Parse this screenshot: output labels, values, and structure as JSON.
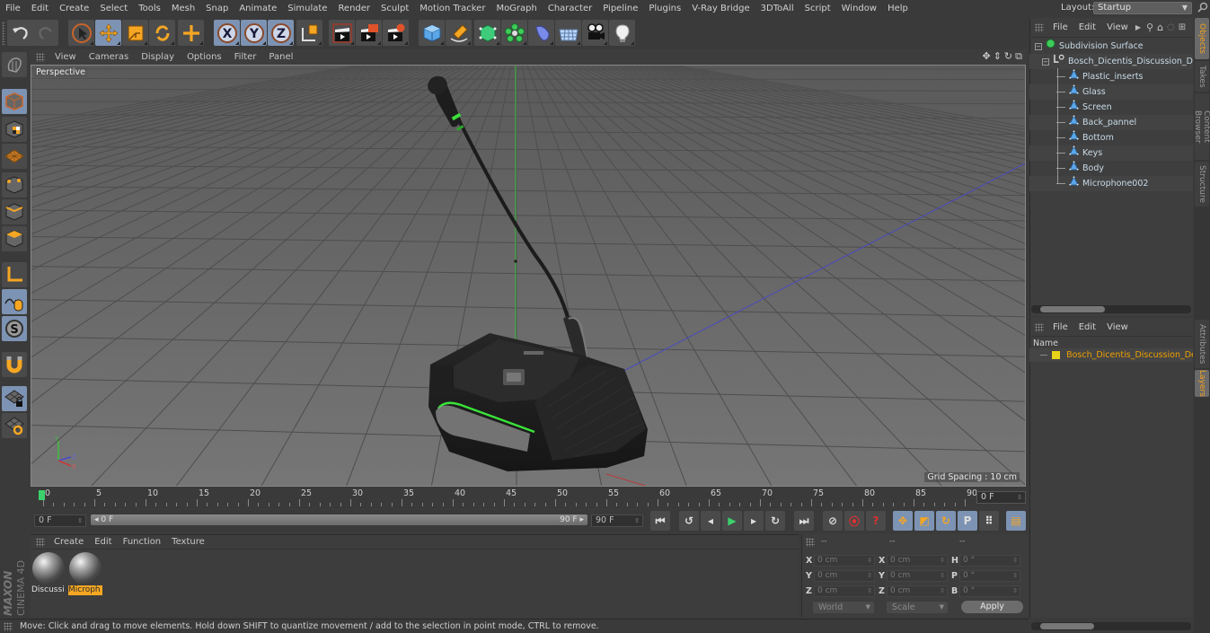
{
  "menubar": {
    "items": [
      "File",
      "Edit",
      "Create",
      "Select",
      "Tools",
      "Mesh",
      "Snap",
      "Animate",
      "Simulate",
      "Render",
      "Sculpt",
      "Motion Tracker",
      "MoGraph",
      "Character",
      "Pipeline",
      "Plugins",
      "V-Ray Bridge",
      "3DToAll",
      "Script",
      "Window",
      "Help"
    ],
    "layout_label": "Layout:",
    "layout_value": "Startup"
  },
  "toolbar": {
    "buttons": [
      {
        "name": "undo",
        "icon": "undo-icon",
        "active": false
      },
      {
        "name": "redo",
        "icon": "redo-icon",
        "active": false
      },
      {
        "name": "live-selection",
        "icon": "cursor-icon",
        "active": false
      },
      {
        "name": "move",
        "icon": "move-icon",
        "active": true
      },
      {
        "name": "scale",
        "icon": "scale-icon",
        "active": false
      },
      {
        "name": "rotate",
        "icon": "rotate-icon",
        "active": false
      },
      {
        "name": "last-tool",
        "icon": "plus-icon",
        "active": false
      },
      {
        "name": "x-axis",
        "icon": "x-axis-icon",
        "label": "X",
        "active": true
      },
      {
        "name": "y-axis",
        "icon": "y-axis-icon",
        "label": "Y",
        "active": true
      },
      {
        "name": "z-axis",
        "icon": "z-axis-icon",
        "label": "Z",
        "active": true
      },
      {
        "name": "coordinate-system",
        "icon": "coordinate-system-icon",
        "active": false
      },
      {
        "name": "render-view",
        "icon": "clapboard-icon",
        "active": false
      },
      {
        "name": "render-to-picture-viewer",
        "icon": "clapboard-render-icon",
        "active": false
      },
      {
        "name": "render-settings",
        "icon": "clapboard-gear-icon",
        "active": false
      },
      {
        "name": "cube",
        "icon": "cube-icon",
        "active": false
      },
      {
        "name": "pen",
        "icon": "pen-icon",
        "active": false
      },
      {
        "name": "subdivision-surface",
        "icon": "subdivision-icon",
        "active": false
      },
      {
        "name": "cloner",
        "icon": "cloner-icon",
        "active": false
      },
      {
        "name": "deformer",
        "icon": "deformer-icon",
        "active": false
      },
      {
        "name": "floor",
        "icon": "floor-icon",
        "active": false
      },
      {
        "name": "camera",
        "icon": "camera-icon",
        "active": false
      },
      {
        "name": "light",
        "icon": "light-icon",
        "active": false
      }
    ]
  },
  "leftbar": {
    "buttons": [
      {
        "name": "make-editable",
        "icon": "make-editable-icon",
        "active": false
      },
      {
        "name": "model-mode",
        "icon": "model-cube-icon",
        "active": true
      },
      {
        "name": "texture-mode",
        "icon": "texture-checker-icon",
        "active": false
      },
      {
        "name": "workplane-mode",
        "icon": "workplane-icon",
        "active": false
      },
      {
        "name": "points-mode",
        "icon": "points-icon",
        "active": false
      },
      {
        "name": "edges-mode",
        "icon": "edges-icon",
        "active": false
      },
      {
        "name": "polygons-mode",
        "icon": "polygons-icon",
        "active": false
      },
      {
        "name": "axis-mode",
        "icon": "axis-icon",
        "active": false
      },
      {
        "name": "tweak-mode",
        "icon": "mouse-icon",
        "active": true
      },
      {
        "name": "solo-mode",
        "icon": "solo-s-icon",
        "active": true
      },
      {
        "name": "snapping",
        "icon": "magnet-icon",
        "active": false
      },
      {
        "name": "locked-workplane",
        "icon": "workplane-lock-icon",
        "active": true
      },
      {
        "name": "planar-workplane",
        "icon": "workplane-ring-icon",
        "active": false
      }
    ]
  },
  "viewport": {
    "menu": [
      "View",
      "Cameras",
      "Display",
      "Options",
      "Filter",
      "Panel"
    ],
    "label": "Perspective",
    "grid_spacing": "Grid Spacing : 10 cm",
    "nav_icons": [
      "move-view-icon",
      "zoom-view-icon",
      "rotate-view-icon",
      "maximize-view-icon"
    ]
  },
  "timeline": {
    "ticks": [
      "0",
      "5",
      "10",
      "15",
      "20",
      "25",
      "30",
      "35",
      "40",
      "45",
      "50",
      "55",
      "60",
      "65",
      "70",
      "75",
      "80",
      "85",
      "90"
    ],
    "current_frame": "0 F",
    "start_field": "0 F",
    "range_start": "0 F",
    "range_end": "90 F",
    "end_field": "90 F"
  },
  "transport": {
    "buttons": [
      {
        "name": "go-to-start",
        "icon": "go-to-start-icon",
        "glyph": "⏮"
      },
      {
        "name": "previous-key",
        "icon": "previous-key-icon",
        "glyph": "↺"
      },
      {
        "name": "previous-frame",
        "icon": "previous-frame-icon",
        "glyph": "◂"
      },
      {
        "name": "play",
        "icon": "play-icon",
        "glyph": "▶"
      },
      {
        "name": "next-frame",
        "icon": "next-frame-icon",
        "glyph": "▸"
      },
      {
        "name": "next-key",
        "icon": "next-key-icon",
        "glyph": "↻"
      },
      {
        "name": "go-to-end",
        "icon": "go-to-end-icon",
        "glyph": "⏭"
      },
      {
        "name": "record-keys",
        "icon": "record-disabled-icon",
        "glyph": "⊘"
      },
      {
        "name": "autokeying",
        "icon": "autokey-icon",
        "glyph": "⦿"
      },
      {
        "name": "keyframe-selection",
        "icon": "help-key-icon",
        "glyph": "?"
      },
      {
        "name": "position-key",
        "icon": "move-key-icon",
        "glyph": "✥"
      },
      {
        "name": "scale-key",
        "icon": "scale-key-icon",
        "glyph": "◩"
      },
      {
        "name": "rotation-key",
        "icon": "rotation-key-icon",
        "glyph": "↻"
      },
      {
        "name": "parameter-key",
        "icon": "parameter-p-icon",
        "glyph": "P"
      },
      {
        "name": "point-level-key",
        "icon": "point-grid-icon",
        "glyph": "⠿"
      },
      {
        "name": "timeline-window",
        "icon": "film-strip-icon",
        "glyph": "▤"
      }
    ]
  },
  "material_manager": {
    "menu": [
      "Create",
      "Edit",
      "Function",
      "Texture"
    ],
    "materials": [
      {
        "label": "Discussi",
        "selected": false
      },
      {
        "label": "Microph",
        "selected": true
      }
    ]
  },
  "coordinates": {
    "headers": [
      "--",
      "--",
      "--"
    ],
    "rows": [
      {
        "l1": "X",
        "v1": "0 cm",
        "l2": "X",
        "v2": "0 cm",
        "l3": "H",
        "v3": "0 °"
      },
      {
        "l1": "Y",
        "v1": "0 cm",
        "l2": "Y",
        "v2": "0 cm",
        "l3": "P",
        "v3": "0 °"
      },
      {
        "l1": "Z",
        "v1": "0 cm",
        "l2": "Z",
        "v2": "0 cm",
        "l3": "B",
        "v3": "0 °"
      }
    ],
    "mode_select": "World",
    "size_select": "Scale",
    "apply_label": "Apply"
  },
  "status": {
    "text": "Move: Click and drag to move elements. Hold down SHIFT to quantize movement / add to the selection in point mode, CTRL to remove."
  },
  "object_manager": {
    "menu": [
      "File",
      "Edit",
      "View"
    ],
    "objects": [
      {
        "name": "Subdivision Surface",
        "type": "subdivision",
        "level": 0
      },
      {
        "name": "Bosch_Dicentis_Discussion_Device",
        "type": "null",
        "level": 1
      },
      {
        "name": "Plastic_inserts",
        "type": "polygon",
        "level": 2
      },
      {
        "name": "Glass",
        "type": "polygon",
        "level": 2
      },
      {
        "name": "Screen",
        "type": "polygon",
        "level": 2
      },
      {
        "name": "Back_pannel",
        "type": "polygon",
        "level": 2
      },
      {
        "name": "Bottom",
        "type": "polygon",
        "level": 2
      },
      {
        "name": "Keys",
        "type": "polygon",
        "level": 2
      },
      {
        "name": "Body",
        "type": "polygon",
        "level": 2
      },
      {
        "name": "Microphone002",
        "type": "polygon",
        "level": 2
      }
    ]
  },
  "layer_manager": {
    "menu": [
      "File",
      "Edit",
      "View"
    ],
    "column_header": "Name",
    "layers": [
      {
        "name": "Bosch_Dicentis_Discussion_Device",
        "color": "#e8d21a"
      }
    ]
  },
  "side_tabs": {
    "top": [
      {
        "label": "Objects",
        "active": true
      },
      {
        "label": "Takes",
        "active": false
      },
      {
        "label": "Content Browser",
        "active": false
      },
      {
        "label": "Structure",
        "active": false
      }
    ],
    "bottom": [
      {
        "label": "Attributes",
        "active": false
      },
      {
        "label": "Layers",
        "active": true
      }
    ]
  },
  "branding": {
    "brand": "MAXON",
    "product": "CINEMA 4D"
  },
  "colors": {
    "accent_orange": "#f5a623",
    "active_button": "#7d93b3",
    "play_green": "#3bd26b",
    "axis_y": "#37c837",
    "axis_x": "#c83a3a",
    "axis_z": "#3a3ac8"
  }
}
